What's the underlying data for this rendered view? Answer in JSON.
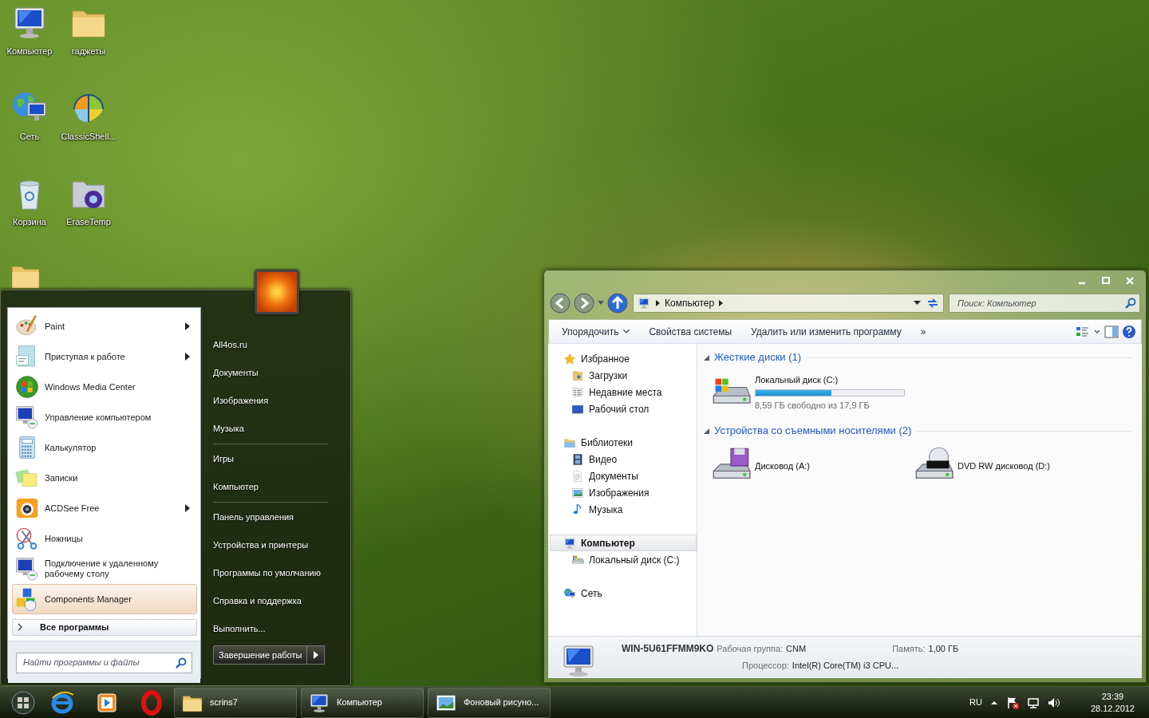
{
  "desktop_icons": [
    {
      "label": "Компьютер"
    },
    {
      "label": "гаджеты"
    },
    {
      "label": "Сеть"
    },
    {
      "label": "ClassicShell..."
    },
    {
      "label": "Корзина"
    },
    {
      "label": "EraseTemp"
    }
  ],
  "start_menu": {
    "programs": [
      {
        "label": "Paint",
        "submenu": true,
        "selected": false
      },
      {
        "label": "Приступая к работе",
        "submenu": true,
        "selected": false
      },
      {
        "label": "Windows Media Center",
        "submenu": false,
        "selected": false
      },
      {
        "label": "Управление компьютером",
        "submenu": false,
        "selected": false
      },
      {
        "label": "Калькулятор",
        "submenu": false,
        "selected": false
      },
      {
        "label": "Записки",
        "submenu": false,
        "selected": false
      },
      {
        "label": "ACDSee Free",
        "submenu": true,
        "selected": false
      },
      {
        "label": "Ножницы",
        "submenu": false,
        "selected": false
      },
      {
        "label": "Подключение к удаленному рабочему столу",
        "submenu": false,
        "selected": false
      },
      {
        "label": "Components Manager",
        "submenu": false,
        "selected": true
      }
    ],
    "all_programs": "Все программы",
    "search": {
      "placeholder": "Найти программы и файлы"
    },
    "places": [
      [
        "All4os.ru",
        "Документы",
        "Изображения",
        "Музыка"
      ],
      [
        "Игры",
        "Компьютер"
      ],
      [
        "Панель управления",
        "Устройства и принтеры",
        "Программы по умолчанию",
        "Справка и поддержка",
        "Выполнить..."
      ]
    ],
    "shutdown": "Завершение работы"
  },
  "explorer": {
    "address": [
      "Компьютер"
    ],
    "search": {
      "placeholder": "Поиск: Компьютер"
    },
    "toolbar": [
      {
        "label": "Упорядочить",
        "dropdown": true
      },
      {
        "label": "Свойства системы",
        "dropdown": false
      },
      {
        "label": "Удалить или изменить программу",
        "dropdown": false
      }
    ],
    "toolbar_more": "»",
    "nav_pane": [
      {
        "label": "Избранное",
        "selected": false,
        "children": [
          {
            "label": "Загрузки",
            "selected": false
          },
          {
            "label": "Недавние места",
            "selected": false
          },
          {
            "label": "Рабочий стол",
            "selected": false
          }
        ]
      },
      {
        "label": "Библиотеки",
        "selected": false,
        "children": [
          {
            "label": "Видео",
            "selected": false
          },
          {
            "label": "Документы",
            "selected": false
          },
          {
            "label": "Изображения",
            "selected": false
          },
          {
            "label": "Музыка",
            "selected": false
          }
        ]
      },
      {
        "label": "Компьютер",
        "selected": true,
        "children": [
          {
            "label": "Локальный диск (C:)",
            "selected": false
          }
        ]
      },
      {
        "label": "Сеть",
        "selected": false
      }
    ],
    "sections": [
      {
        "title": "Жесткие диски (1)",
        "expanded": true,
        "items": [
          {
            "kind": "disk",
            "name": "Локальный диск (C:)",
            "level": 0.51,
            "reading": "8,59 ГБ свободно из 17,9 ГБ"
          }
        ]
      },
      {
        "title": "Устройства со съемными носителями (2)",
        "expanded": true,
        "items": [
          {
            "kind": "device",
            "name": "Дисковод (A:)"
          },
          {
            "kind": "device",
            "name": "DVD RW дисковод (D:)"
          }
        ]
      }
    ],
    "details": {
      "name": "WIN-5U61FFMM9KO",
      "fields": [
        {
          "label": "Рабочая группа:",
          "value": "CNM"
        },
        {
          "label": "Память:",
          "value": "1,00 ГБ"
        },
        {
          "label": "Процессор:",
          "value": "Intel(R) Core(TM) i3 CPU..."
        }
      ]
    }
  },
  "taskbar": {
    "tasks": [
      {
        "label": "scrins7"
      },
      {
        "label": "Компьютер"
      },
      {
        "label": "Фоновый рисуно..."
      }
    ],
    "language": "RU",
    "time": "23:39",
    "date": "28.12.2012"
  }
}
